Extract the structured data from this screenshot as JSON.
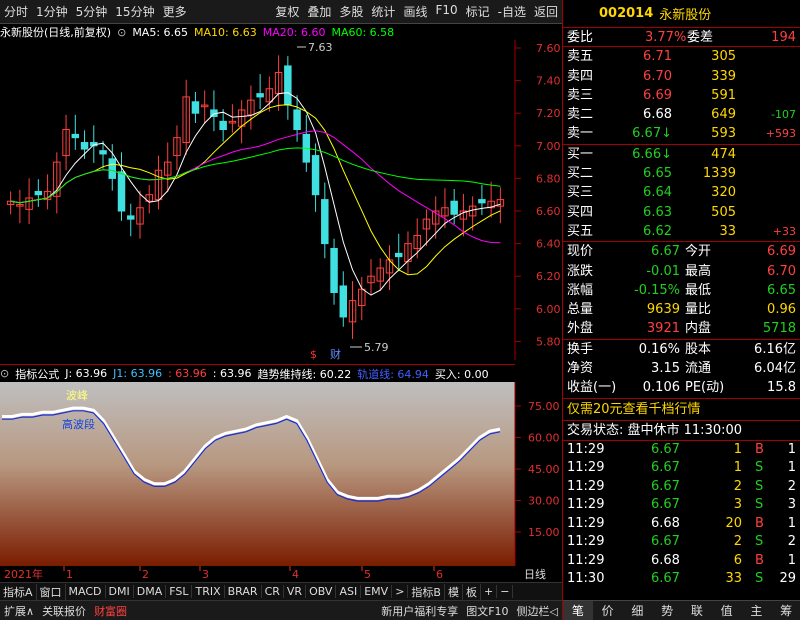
{
  "toolbar": {
    "periods": [
      "分时",
      "1分钟",
      "5分钟",
      "15分钟",
      "更多"
    ],
    "actions": [
      "复权",
      "叠加",
      "多股",
      "统计",
      "画线",
      "F10",
      "标记",
      "-自选",
      "返回"
    ]
  },
  "caption": {
    "title": "永新股份(日线,前复权)",
    "ma5": "MA5: 6.65",
    "ma10": "MA10: 6.63",
    "ma20": "MA20: 6.60",
    "ma60": "MA60: 6.58"
  },
  "price_axis": [
    "7.60",
    "7.40",
    "7.20",
    "7.00",
    "6.80",
    "6.60",
    "6.40",
    "6.20",
    "6.00",
    "5.80"
  ],
  "high_marker": "7.63",
  "low_marker": "5.79",
  "event_marks": [
    "$",
    "财"
  ],
  "indicator": {
    "name": "指标公式",
    "j": "J: 63.96",
    "j1": "J1: 63.96",
    "v1": ": 63.96",
    "v2": ": 63.96",
    "trend": "趋势维持线: 60.22",
    "track": "轨道线: 64.94",
    "buy": "买入: 0.00",
    "axis": [
      "75.00",
      "60.00",
      "45.00",
      "30.00",
      "15.00"
    ],
    "label_peak": "波峰",
    "label_high": "高波段"
  },
  "date_axis": {
    "year": "2021年",
    "months": [
      "1",
      "2",
      "3",
      "4",
      "5",
      "6"
    ],
    "cycle": "日线"
  },
  "indicator_tabs": [
    "指标A",
    "窗口",
    "MACD",
    "DMI",
    "DMA",
    "FSL",
    "TRIX",
    "BRAR",
    "CR",
    "VR",
    "OBV",
    "ASI",
    "EMV",
    ">",
    "指标B",
    "模",
    "板",
    "+",
    "−"
  ],
  "bottom_tabs": [
    "扩展∧",
    "关联报价",
    "财富圈"
  ],
  "bottom_right": [
    "新用户福利专享",
    "图文F10",
    "侧边栏◁"
  ],
  "quote": {
    "code": "002014",
    "name": "永新股份",
    "weibi_label": "委比",
    "weibi": "3.77%",
    "weicha_label": "委差",
    "weicha": "194",
    "asks": [
      {
        "label": "卖五",
        "price": "6.71",
        "vol": "305",
        "chg": ""
      },
      {
        "label": "卖四",
        "price": "6.70",
        "vol": "339",
        "chg": ""
      },
      {
        "label": "卖三",
        "price": "6.69",
        "vol": "591",
        "chg": ""
      },
      {
        "label": "卖二",
        "price": "6.68",
        "vol": "649",
        "chg": "-107"
      },
      {
        "label": "卖一",
        "price": "6.67↓",
        "vol": "593",
        "chg": "+593"
      }
    ],
    "bids": [
      {
        "label": "买一",
        "price": "6.66↓",
        "vol": "474",
        "chg": ""
      },
      {
        "label": "买二",
        "price": "6.65",
        "vol": "1339",
        "chg": ""
      },
      {
        "label": "买三",
        "price": "6.64",
        "vol": "320",
        "chg": ""
      },
      {
        "label": "买四",
        "price": "6.63",
        "vol": "505",
        "chg": ""
      },
      {
        "label": "买五",
        "price": "6.62",
        "vol": "33",
        "chg": "+33"
      }
    ],
    "stats": [
      {
        "l1": "现价",
        "v1": "6.67",
        "l2": "今开",
        "v2": "6.69"
      },
      {
        "l1": "涨跌",
        "v1": "-0.01",
        "l2": "最高",
        "v2": "6.70"
      },
      {
        "l1": "涨幅",
        "v1": "-0.15%",
        "l2": "最低",
        "v2": "6.65"
      },
      {
        "l1": "总量",
        "v1": "9639",
        "l2": "量比",
        "v2": "0.96"
      },
      {
        "l1": "外盘",
        "v1": "3921",
        "l2": "内盘",
        "v2": "5718"
      }
    ],
    "fin": [
      {
        "l1": "换手",
        "v1": "0.16%",
        "l2": "股本",
        "v2": "6.16亿"
      },
      {
        "l1": "净资",
        "v1": "3.15",
        "l2": "流通",
        "v2": "6.04亿"
      },
      {
        "l1": "收益(一)",
        "v1": "0.106",
        "l2": "PE(动)",
        "v2": "15.8"
      }
    ],
    "promo": "仅需20元查看千档行情",
    "status": "交易状态: 盘中休市 11:30:00",
    "ticks": [
      {
        "t": "11:29",
        "p": "6.67",
        "v": "1",
        "s": "B",
        "n": "1"
      },
      {
        "t": "11:29",
        "p": "6.67",
        "v": "1",
        "s": "S",
        "n": "1"
      },
      {
        "t": "11:29",
        "p": "6.67",
        "v": "2",
        "s": "S",
        "n": "2"
      },
      {
        "t": "11:29",
        "p": "6.67",
        "v": "3",
        "s": "S",
        "n": "3"
      },
      {
        "t": "11:29",
        "p": "6.68",
        "v": "20",
        "s": "B",
        "n": "1"
      },
      {
        "t": "11:29",
        "p": "6.67",
        "v": "2",
        "s": "S",
        "n": "2"
      },
      {
        "t": "11:29",
        "p": "6.68",
        "v": "6",
        "s": "B",
        "n": "1"
      },
      {
        "t": "11:30",
        "p": "6.67",
        "v": "33",
        "s": "S",
        "n": "29"
      }
    ],
    "tabs": [
      "笔",
      "价",
      "细",
      "势",
      "联",
      "值",
      "主",
      "筹"
    ]
  },
  "colors": {
    "up": "#ff4040",
    "down": "#20d020",
    "ma5": "#ffffff",
    "ma10": "#ffff00",
    "ma20": "#ff00ff",
    "ma60": "#00ff00",
    "axis": "#a00000"
  }
}
